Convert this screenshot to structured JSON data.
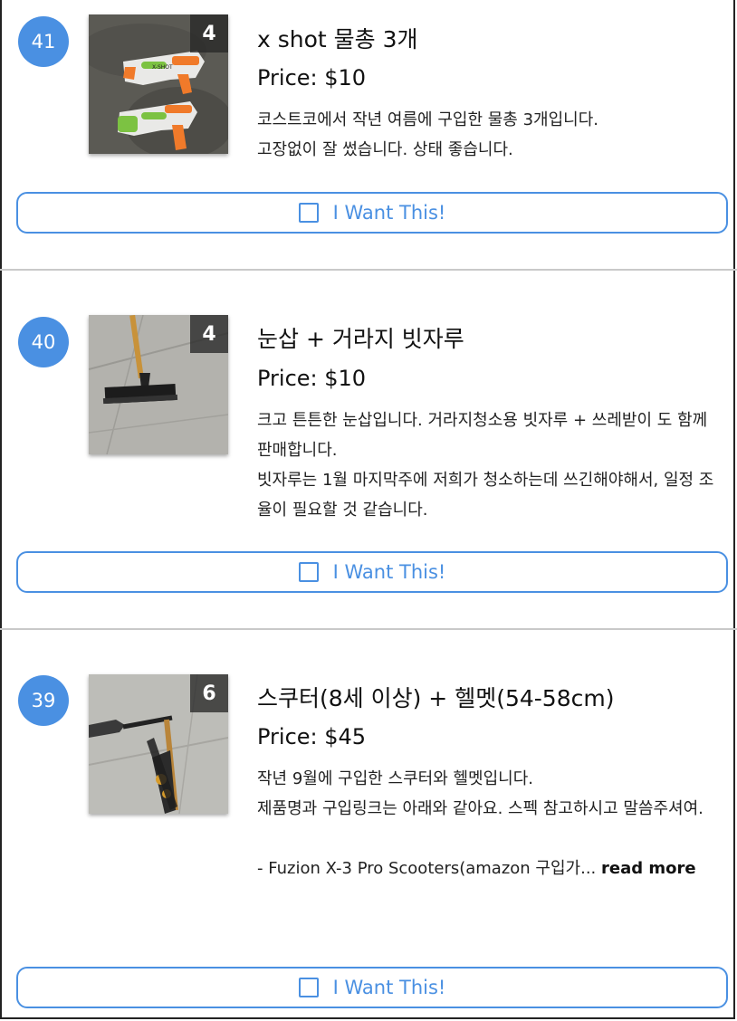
{
  "listings": [
    {
      "number": "41",
      "photo_count": "4",
      "title": "x shot 물총 3개",
      "price": "Price: $10",
      "description": [
        "코스트코에서 작년 여름에 구입한 물총 3개입니다.",
        "고장없이 잘 썼습니다. 상태 좋습니다."
      ],
      "button_label": "I Want This!"
    },
    {
      "number": "40",
      "photo_count": "4",
      "title": "눈삽 + 거라지 빗자루",
      "price": "Price: $10",
      "description": [
        "크고 튼튼한 눈삽입니다. 거라지청소용 빗자루 + 쓰레받이 도 함께 판매합니다.",
        "빗자루는 1월 마지막주에 저희가 청소하는데 쓰긴해야해서, 일정 조율이 필요할 것 같습니다."
      ],
      "button_label": "I Want This!"
    },
    {
      "number": "39",
      "photo_count": "6",
      "title": "스쿠터(8세 이상) + 헬멧(54-58cm)",
      "price": "Price: $45",
      "description": [
        "작년 9월에 구입한 스쿠터와 헬멧입니다.",
        "제품명과 구입링크는 아래와 같아요. 스펙 참고하시고 말씀주셔여.",
        "",
        "- Fuzion X-3 Pro Scooters(amazon 구입가..."
      ],
      "read_more": "read more",
      "button_label": "I Want This!"
    }
  ],
  "colors": {
    "accent": "#4a90e2",
    "divider": "#c9c9c9"
  },
  "icons": [
    "checkbox-icon"
  ]
}
